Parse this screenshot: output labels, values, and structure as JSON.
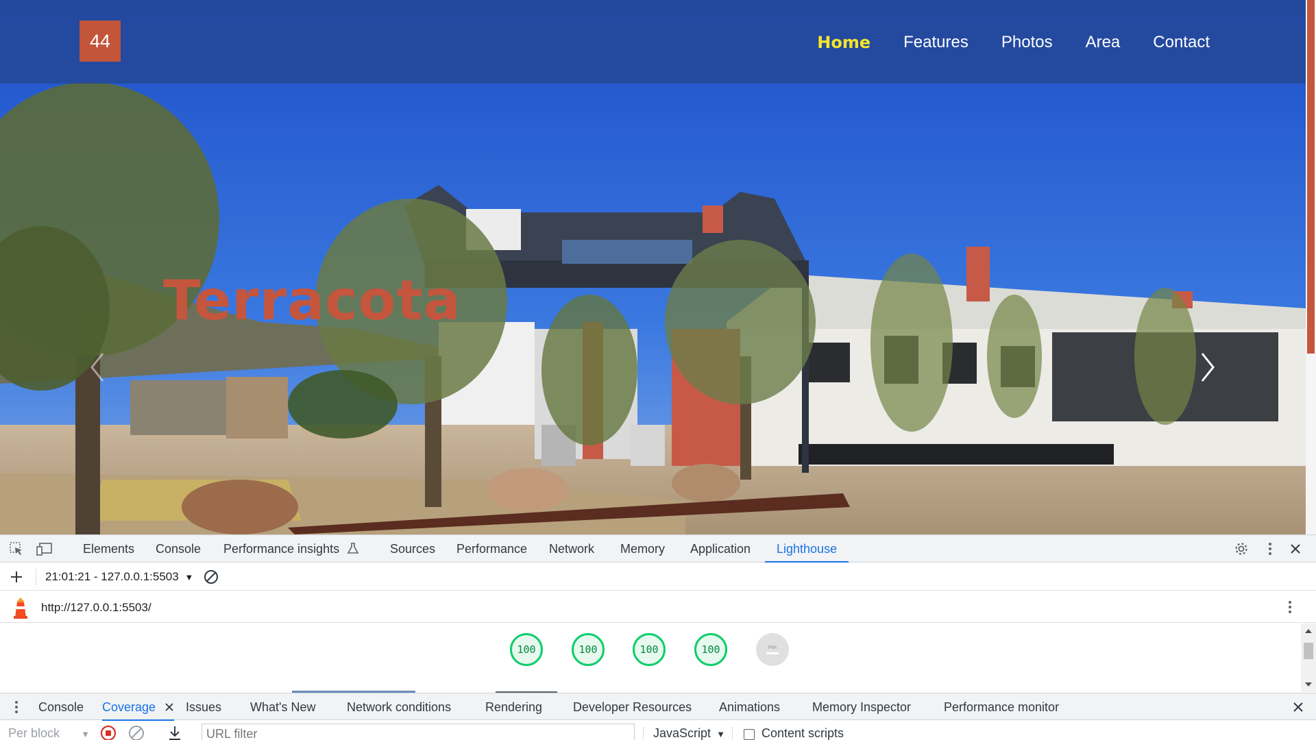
{
  "site": {
    "logo": "44",
    "nav": [
      {
        "label": "Home",
        "active": true
      },
      {
        "label": "Features",
        "active": false
      },
      {
        "label": "Photos",
        "active": false
      },
      {
        "label": "Area",
        "active": false
      },
      {
        "label": "Contact",
        "active": false
      }
    ],
    "hero_title": "Terracota",
    "colors": {
      "header": "#2448a0",
      "accent": "#c4563e",
      "active_nav": "#f5e52a"
    }
  },
  "devtools": {
    "tabs": [
      {
        "label": "Elements",
        "active": false
      },
      {
        "label": "Console",
        "active": false
      },
      {
        "label": "Performance insights",
        "active": false
      },
      {
        "label": "Sources",
        "active": false
      },
      {
        "label": "Performance",
        "active": false
      },
      {
        "label": "Network",
        "active": false
      },
      {
        "label": "Memory",
        "active": false
      },
      {
        "label": "Application",
        "active": false
      },
      {
        "label": "Lighthouse",
        "active": true
      }
    ],
    "lighthouse": {
      "report_selector": "21:01:21 - 127.0.0.1:5503",
      "url": "http://127.0.0.1:5503/",
      "scores": [
        "100",
        "100",
        "100",
        "100"
      ],
      "pwa_label": "PWA"
    },
    "drawer": {
      "tabs": [
        {
          "label": "Console",
          "active": false,
          "closable": false
        },
        {
          "label": "Coverage",
          "active": true,
          "closable": true
        },
        {
          "label": "Issues",
          "active": false,
          "closable": false
        },
        {
          "label": "What's New",
          "active": false,
          "closable": false
        },
        {
          "label": "Network conditions",
          "active": false,
          "closable": false
        },
        {
          "label": "Rendering",
          "active": false,
          "closable": false
        },
        {
          "label": "Developer Resources",
          "active": false,
          "closable": false
        },
        {
          "label": "Animations",
          "active": false,
          "closable": false
        },
        {
          "label": "Memory Inspector",
          "active": false,
          "closable": false
        },
        {
          "label": "Performance monitor",
          "active": false,
          "closable": false
        }
      ],
      "coverage": {
        "granularity": "Per block",
        "url_filter_placeholder": "URL filter",
        "type_filter": "JavaScript",
        "content_scripts_label": "Content scripts"
      }
    }
  }
}
